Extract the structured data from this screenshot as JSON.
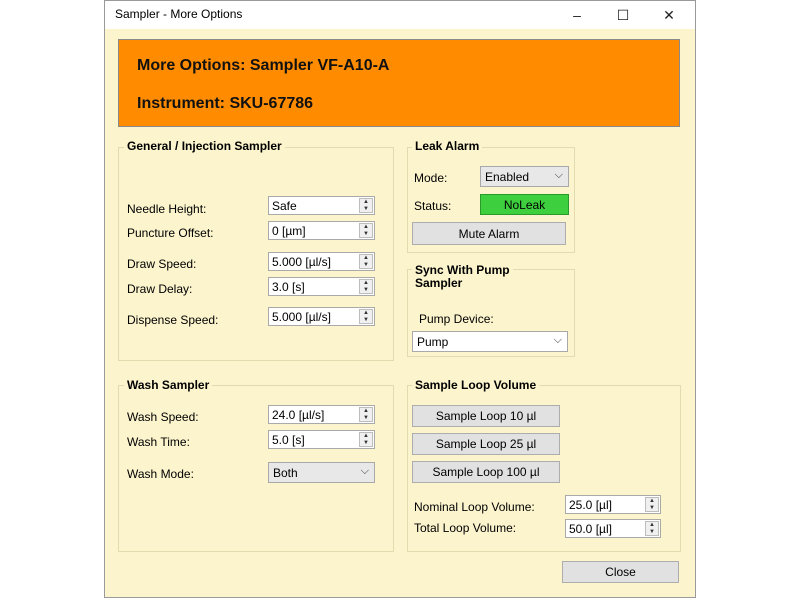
{
  "window": {
    "title": "Sampler - More Options",
    "controls": {
      "minimize": "–",
      "maximize": "☐",
      "close": "✕"
    }
  },
  "banner": {
    "line1": "More Options: Sampler VF-A10-A",
    "line2": "Instrument: SKU-67786",
    "color": "#ff8c00"
  },
  "general": {
    "title": "General / Injection  Sampler",
    "rows": [
      {
        "label": "Needle Height:",
        "value": "Safe"
      },
      {
        "label": "Puncture Offset:",
        "value": "0 [µm]"
      },
      {
        "label": "Draw Speed:",
        "value": "5.000 [µl/s]"
      },
      {
        "label": "Draw Delay:",
        "value": "3.0 [s]"
      },
      {
        "label": "Dispense Speed:",
        "value": "5.000 [µl/s]"
      }
    ]
  },
  "leak": {
    "title": "Leak Alarm",
    "mode_label": "Mode:",
    "mode_value": "Enabled",
    "status_label": "Status:",
    "status_value": "NoLeak",
    "status_color": "#3ecf3e",
    "mute_button": "Mute Alarm"
  },
  "sync": {
    "title_line1": "Sync With Pump",
    "title_line2": "Sampler",
    "device_label": "Pump Device:",
    "device_value": "Pump"
  },
  "wash": {
    "title": "Wash  Sampler",
    "speed_label": "Wash Speed:",
    "speed_value": "24.0 [µl/s]",
    "time_label": "Wash Time:",
    "time_value": "5.0 [s]",
    "mode_label": "Wash Mode:",
    "mode_value": "Both"
  },
  "loop": {
    "title": "Sample Loop Volume",
    "buttons": [
      "Sample Loop 10 µl",
      "Sample Loop 25 µl",
      "Sample Loop 100 µl"
    ],
    "nominal_label": "Nominal Loop Volume:",
    "nominal_value": "25.0 [µl]",
    "total_label": "Total Loop Volume:",
    "total_value": "50.0 [µl]"
  },
  "footer": {
    "close_button": "Close"
  }
}
